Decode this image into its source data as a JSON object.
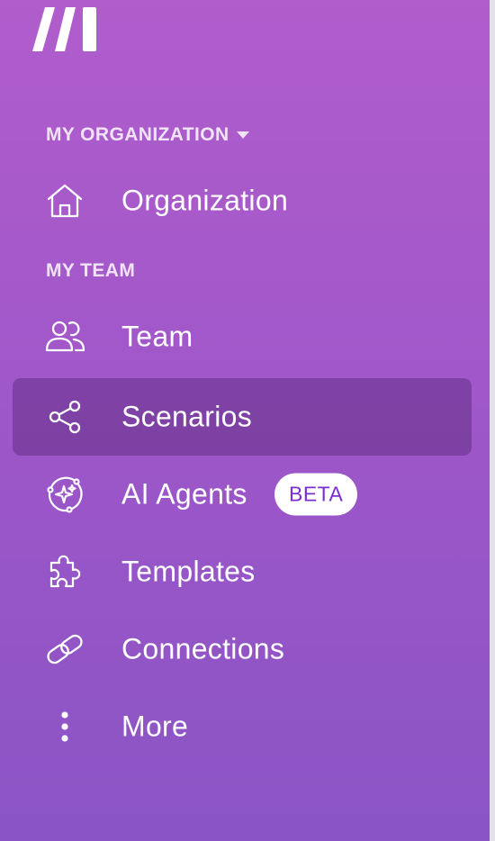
{
  "logo": {
    "name": "make-logo"
  },
  "sections": {
    "organization": "MY ORGANIZATION",
    "team": "MY TEAM"
  },
  "nav": {
    "organization": {
      "label": "Organization",
      "icon": "home-icon"
    },
    "team": {
      "label": "Team",
      "icon": "users-icon"
    },
    "scenarios": {
      "label": "Scenarios",
      "icon": "share-icon",
      "active": true
    },
    "ai_agents": {
      "label": "AI Agents",
      "icon": "ai-sparkle-icon",
      "badge": "BETA"
    },
    "templates": {
      "label": "Templates",
      "icon": "puzzle-icon"
    },
    "connections": {
      "label": "Connections",
      "icon": "link-icon"
    },
    "more": {
      "label": "More",
      "icon": "more-vertical-icon"
    }
  },
  "colors": {
    "background_top": "#b15dcc",
    "background_bottom": "#8a54c4",
    "active_item": "#7a3f9e",
    "badge_text": "#7a2fd0"
  }
}
